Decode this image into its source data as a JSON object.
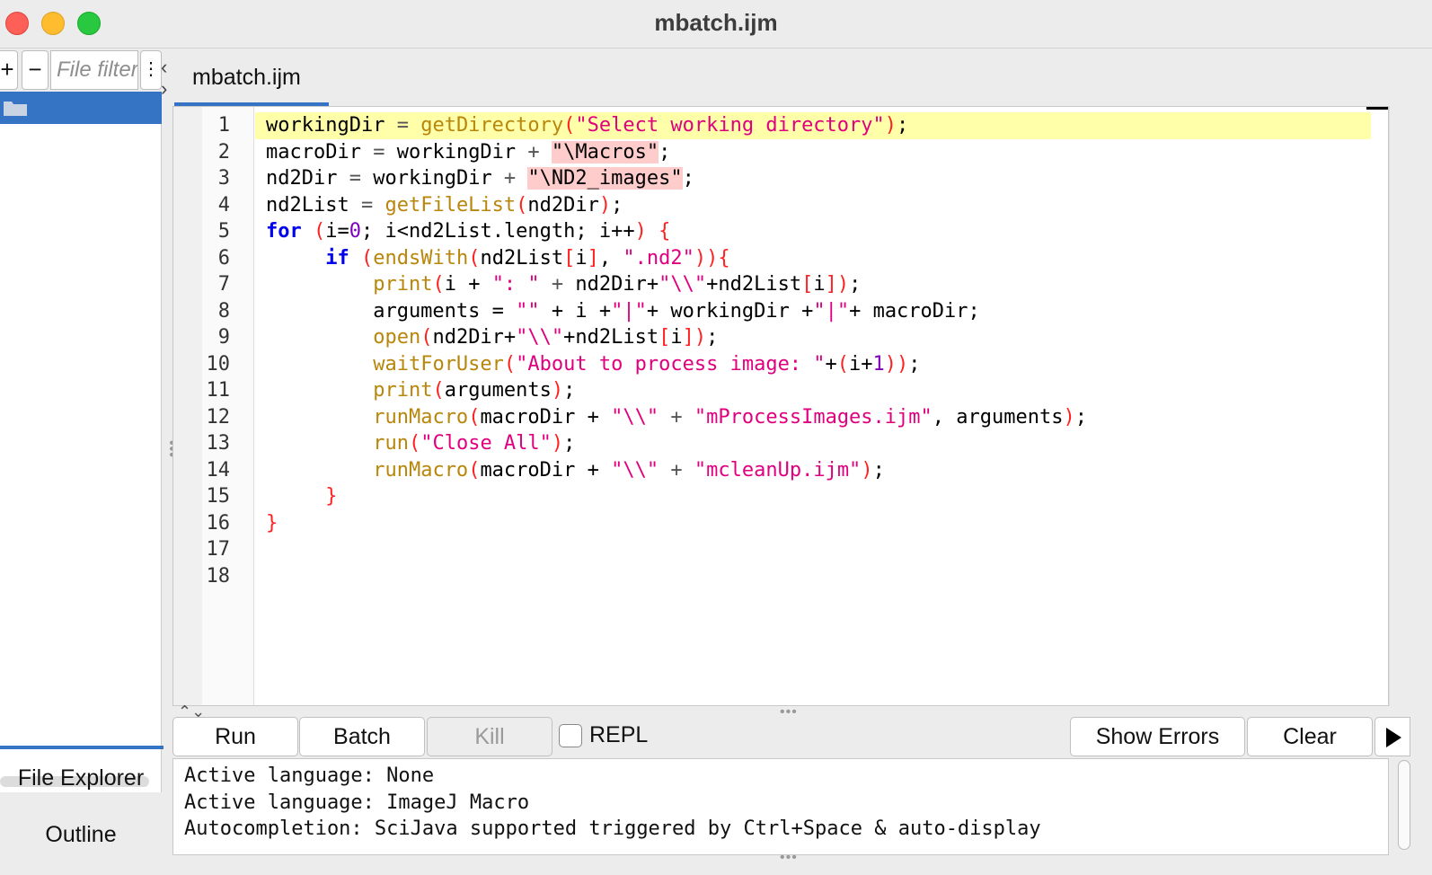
{
  "window": {
    "title": "mbatch.ijm"
  },
  "left": {
    "add_label": "+",
    "remove_label": "−",
    "filter_placeholder": "File filter...",
    "menu_label": "⋮",
    "tabs": [
      {
        "label": "File Explorer"
      },
      {
        "label": "Outline"
      }
    ]
  },
  "editor": {
    "tab_label": "mbatch.ijm",
    "line_numbers": [
      "1",
      "2",
      "3",
      "4",
      "5",
      "6",
      "7",
      "8",
      "9",
      "10",
      "11",
      "12",
      "13",
      "14",
      "15",
      "16",
      "17",
      "18"
    ]
  },
  "buttons": {
    "run": "Run",
    "batch": "Batch",
    "kill": "Kill",
    "repl": "REPL",
    "show_errors": "Show Errors",
    "clear": "Clear"
  },
  "console": {
    "lines": [
      "Active language: None",
      "Active language: ImageJ Macro",
      "Autocompletion: SciJava supported triggered by Ctrl+Space & auto-display"
    ]
  },
  "colors": {
    "selection_blue": "#3574c4",
    "current_line": "#ffffaa",
    "function": "#b8860b",
    "keyword": "#0000ee",
    "string": "#e0007f",
    "paren": "#ff2020"
  }
}
